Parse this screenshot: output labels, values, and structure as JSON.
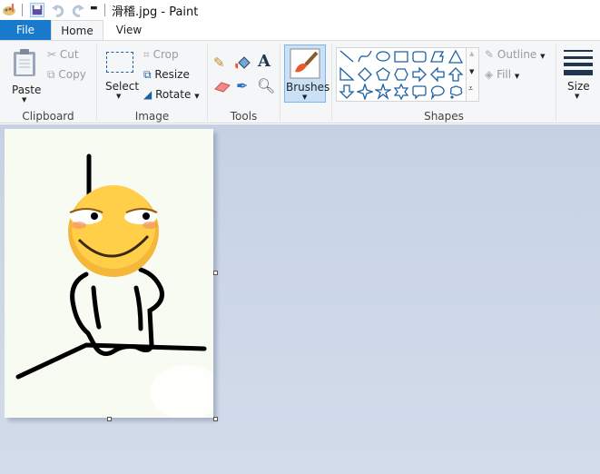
{
  "window": {
    "title": "滑稽.jpg - Paint"
  },
  "quick_access": {
    "icons": [
      "paint-app-icon",
      "save-icon",
      "undo-icon",
      "redo-icon",
      "customize-dropdown-icon"
    ]
  },
  "tabs": [
    {
      "label": "File"
    },
    {
      "label": "Home"
    },
    {
      "label": "View"
    }
  ],
  "clipboard": {
    "group": "Clipboard",
    "paste": "Paste",
    "cut": "Cut",
    "copy": "Copy"
  },
  "image": {
    "group": "Image",
    "select": "Select",
    "crop": "Crop",
    "resize": "Resize",
    "rotate": "Rotate"
  },
  "tools": {
    "group": "Tools",
    "items": [
      "pencil",
      "fill",
      "text",
      "eraser",
      "color-picker",
      "magnifier"
    ]
  },
  "brushes": {
    "label": "Brushes"
  },
  "shapes": {
    "group": "Shapes",
    "outline": "Outline",
    "fill": "Fill",
    "items": [
      "line",
      "curve",
      "oval",
      "rectangle",
      "rounded-rectangle",
      "polygon",
      "triangle",
      "right-triangle",
      "diamond",
      "pentagon",
      "hexagon",
      "right-arrow",
      "left-arrow",
      "up-arrow",
      "down-arrow",
      "four-point-star",
      "five-point-star",
      "six-point-star",
      "rounded-callout",
      "oval-callout",
      "cloud-callout"
    ]
  },
  "size": {
    "label": "Size"
  },
  "colors": {
    "accent": "#1979ca",
    "shape_stroke": "#1e5fa3",
    "canvas_bg": "#cbd5e5"
  }
}
